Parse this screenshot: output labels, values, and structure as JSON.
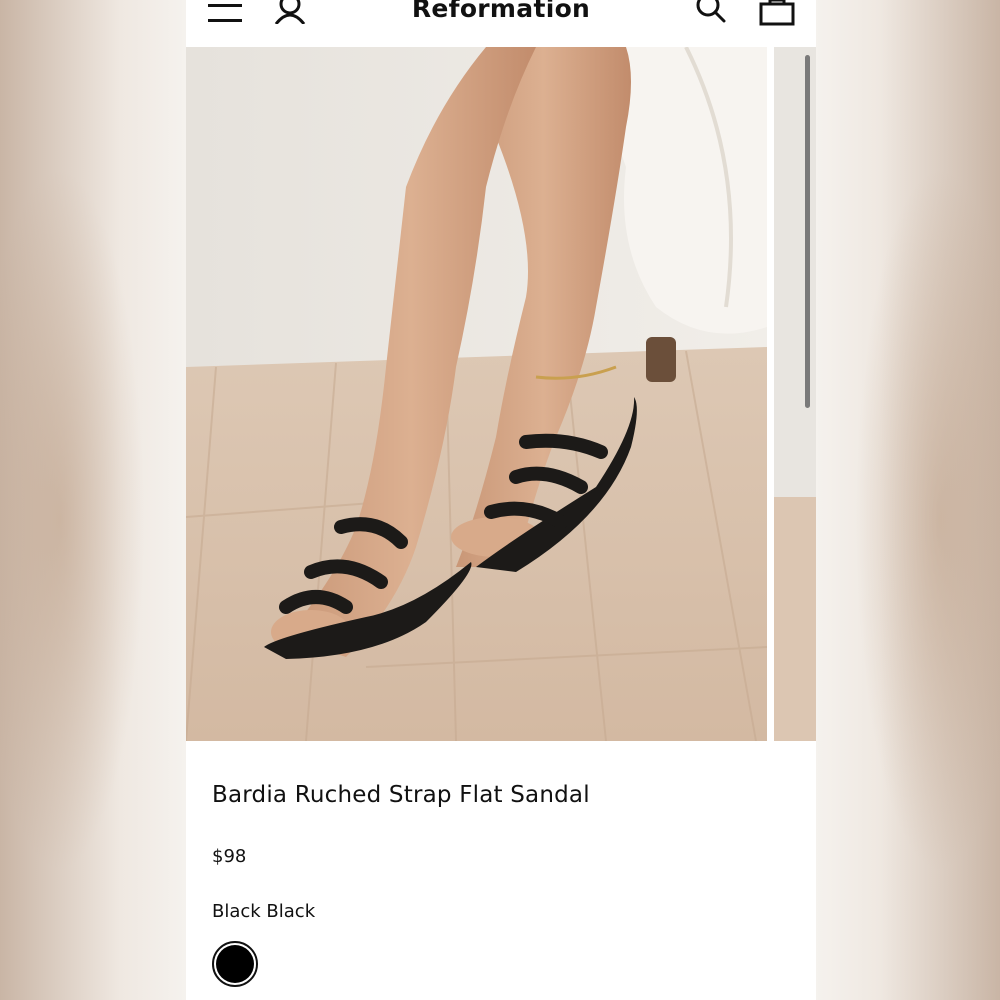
{
  "header": {
    "brand": "Reformation",
    "icons": [
      "menu-icon",
      "account-icon",
      "search-icon",
      "bag-icon"
    ]
  },
  "product": {
    "title": "Bardia Ruched Strap Flat Sandal",
    "price": "$98",
    "color_label": "Black Black",
    "swatches": [
      {
        "name": "Black",
        "color": "#000000",
        "selected": true
      }
    ]
  },
  "colors": {
    "background": "#ffffff",
    "text": "#111111",
    "wall": "#e9e4dd",
    "floor": "#d9c3ae",
    "sandal": "#1c1a18",
    "skin": "#d4a585"
  }
}
